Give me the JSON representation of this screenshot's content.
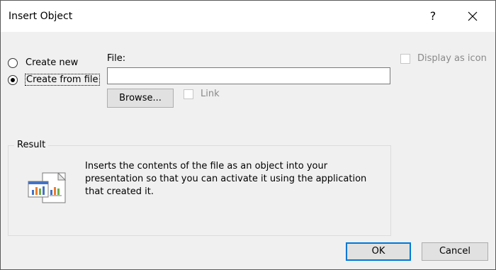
{
  "dialog": {
    "title": "Insert Object",
    "help_label": "?"
  },
  "options": {
    "create_new": "Create new",
    "create_from_file": "Create from file",
    "selected": "create_from_file"
  },
  "file": {
    "label": "File:",
    "value": "",
    "browse_label": "Browse...",
    "link_label": "Link",
    "link_checked": false
  },
  "display_as_icon": {
    "label": "Display as icon",
    "checked": false
  },
  "result": {
    "label": "Result",
    "text": "Inserts the contents of the file as an object into your presentation so that you can activate it using the application that created it.",
    "icon": "object-file-icon"
  },
  "buttons": {
    "ok": "OK",
    "cancel": "Cancel"
  },
  "colors": {
    "accent": "#0078d7",
    "dialog_bg": "#f0f0f0",
    "disabled_text": "#8a8a8a"
  }
}
